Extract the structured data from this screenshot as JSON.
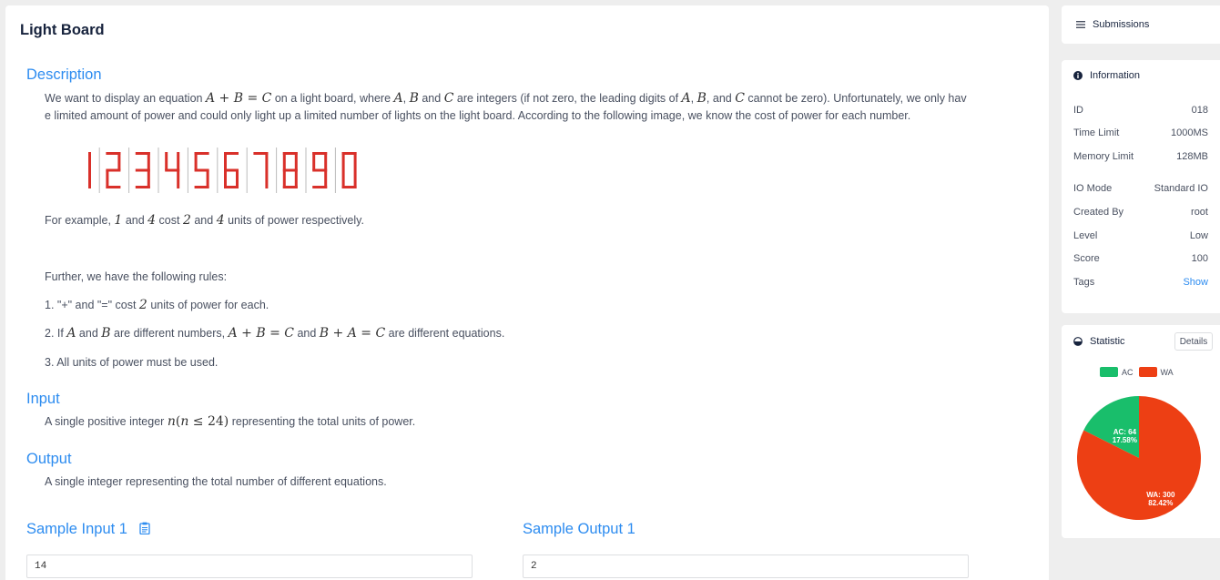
{
  "problem": {
    "title": "Light Board",
    "description_heading": "Description",
    "desc_p1_line1_a": "We want to display an equation ",
    "desc_p1_line1_b": " on a light board, where ",
    "desc_p1_line1_c": " and ",
    "desc_p1_line1_d": " are integers (if not zero, the leading digits of ",
    "desc_p1_line1_e": ", and ",
    "desc_p1_line1_f": " cannot be zero). Unfortunately, we only hav",
    "desc_p1_line2": "e limited amount of power and could only light up a limited number of lights on the light board. According to the following image, we know the cost of power for each number.",
    "digits": [
      "1",
      "2",
      "3",
      "4",
      "5",
      "6",
      "7",
      "8",
      "9",
      "0"
    ],
    "example_a": "For example, ",
    "example_b": " and ",
    "example_c": " cost ",
    "example_d": " and ",
    "example_e": " units of power respectively.",
    "rules_intro": "Further, we have the following rules:",
    "rule1_a": "1. \"+\" and \"=\" cost ",
    "rule1_b": " units of power for each.",
    "rule2_a": "2. If ",
    "rule2_b": " and ",
    "rule2_c": " are different numbers, ",
    "rule2_d": " and ",
    "rule2_e": " are different equations.",
    "rule3": "3. All units of power must be used.",
    "input_heading": "Input",
    "input_a": "A single positive integer ",
    "input_b": " representing the total units of power.",
    "output_heading": "Output",
    "output_text": "A single integer representing the total number of different equations.",
    "sample_input_heading": "Sample Input 1",
    "sample_output_heading": "Sample Output 1",
    "sample_input_value": "14",
    "sample_output_value": "2"
  },
  "submissions": {
    "label": "Submissions"
  },
  "information": {
    "label": "Information",
    "rows": [
      {
        "key": "ID",
        "value": "018"
      },
      {
        "key": "Time Limit",
        "value": "1000MS"
      },
      {
        "key": "Memory Limit",
        "value": "128MB"
      },
      {
        "key": "IO Mode",
        "value": "Standard IO"
      },
      {
        "key": "Created By",
        "value": "root"
      },
      {
        "key": "Level",
        "value": "Low"
      },
      {
        "key": "Score",
        "value": "100"
      },
      {
        "key": "Tags",
        "value": "Show"
      }
    ]
  },
  "statistic": {
    "label": "Statistic",
    "details_label": "Details",
    "legend": [
      {
        "name": "AC",
        "color": "#19be6b"
      },
      {
        "name": "WA",
        "color": "#ed3f14"
      }
    ],
    "slices": [
      {
        "name": "AC",
        "value": 64,
        "label1": "AC: 64",
        "label2": "17.58%",
        "color": "#19be6b"
      },
      {
        "name": "WA",
        "value": 300,
        "label1": "WA: 300",
        "label2": "82.42%",
        "color": "#ed3f14"
      }
    ]
  },
  "colors": {
    "accent": "#2d8cf0",
    "digit_red": "#d9302a"
  }
}
